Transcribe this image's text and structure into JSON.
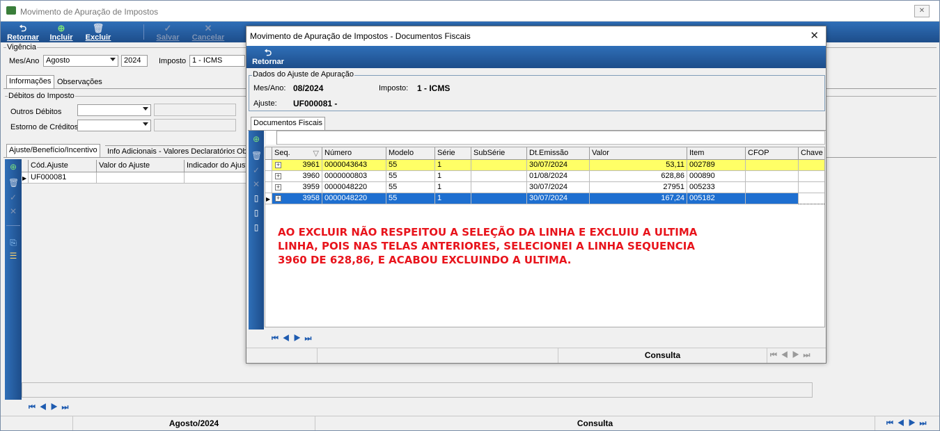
{
  "app": {
    "title": "Movimento de Apuração de Impostos"
  },
  "toolbar": {
    "retornar": "Retornar",
    "incluir": "Incluir",
    "excluir": "Excluir",
    "salvar": "Salvar",
    "cancelar": "Cancelar"
  },
  "vigencia": {
    "group_label": "Vigência",
    "mes_ano_label": "Mes/Ano",
    "mes_value": "Agosto",
    "ano_value": "2024",
    "imposto_label": "Imposto",
    "imposto_value": "1 - ICMS"
  },
  "main_tabs": [
    "Informações",
    "Observações"
  ],
  "debitos": {
    "group_label": "Débitos do Imposto",
    "outros_debitos_label": "Outros Débitos",
    "estorno_creditos_label": "Estorno de Créditos"
  },
  "sub_tabs": [
    "Ajuste/Benefício/Incentivo",
    "Info Adicionais - Valores Declaratórios",
    "Ob"
  ],
  "ajuste_grid": {
    "headers": [
      "Cód.Ajuste",
      "Valor do Ajuste",
      "Indicador do Ajuste"
    ],
    "rows": [
      {
        "codigo": "UF000081",
        "valor": "",
        "indicador": ""
      }
    ]
  },
  "main_status": {
    "period": "Agosto/2024",
    "mode": "Consulta"
  },
  "dialog": {
    "title": "Movimento de Apuração de Impostos - Documentos Fiscais",
    "retornar": "Retornar",
    "dados_group_label": "Dados do Ajuste de Apuração",
    "mes_ano_label": "Mes/Ano:",
    "mes_ano_value": "08/2024",
    "imposto_label": "Imposto:",
    "imposto_value": "1 - ICMS",
    "ajuste_label": "Ajuste:",
    "ajuste_value": "UF000081 -",
    "tab": "Documentos Fiscais",
    "grid_headers": [
      "Seq.",
      "Número",
      "Modelo",
      "Série",
      "SubSérie",
      "Dt.Emissão",
      "Valor",
      "Item",
      "CFOP",
      "Chave"
    ],
    "grid_rows": [
      {
        "seq": "3961",
        "numero": "0000043643",
        "modelo": "55",
        "serie": "1",
        "subserie": "",
        "dt": "30/07/2024",
        "valor": "53,11",
        "item": "002789",
        "cfop": "",
        "chave": "",
        "state": "highlight"
      },
      {
        "seq": "3960",
        "numero": "0000000803",
        "modelo": "55",
        "serie": "1",
        "subserie": "",
        "dt": "01/08/2024",
        "valor": "628,86",
        "item": "000890",
        "cfop": "",
        "chave": "",
        "state": "normal"
      },
      {
        "seq": "3959",
        "numero": "0000048220",
        "modelo": "55",
        "serie": "1",
        "subserie": "",
        "dt": "30/07/2024",
        "valor": "27951",
        "item": "005233",
        "cfop": "",
        "chave": "",
        "state": "normal"
      },
      {
        "seq": "3958",
        "numero": "0000048220",
        "modelo": "55",
        "serie": "1",
        "subserie": "",
        "dt": "30/07/2024",
        "valor": "167,24",
        "item": "005182",
        "cfop": "",
        "chave": "",
        "state": "selected"
      }
    ],
    "status_mode": "Consulta"
  },
  "annotation": {
    "line1": "AO EXCLUIR NÃO RESPEITOU A SELEÇÃO DA LINHA E EXCLUIU A ULTIMA",
    "line2": "LINHA, POIS NAS TELAS ANTERIORES, SELECIONEI A LINHA SEQUENCIA",
    "line3": "3960 DE 628,86, E ACABOU EXCLUINDO A ULTIMA."
  },
  "colors": {
    "toolbar_blue": "#2f6fb8",
    "row_highlight": "#ffff66",
    "row_selected": "#1e6fd0",
    "annotation_red": "#e8141c"
  }
}
